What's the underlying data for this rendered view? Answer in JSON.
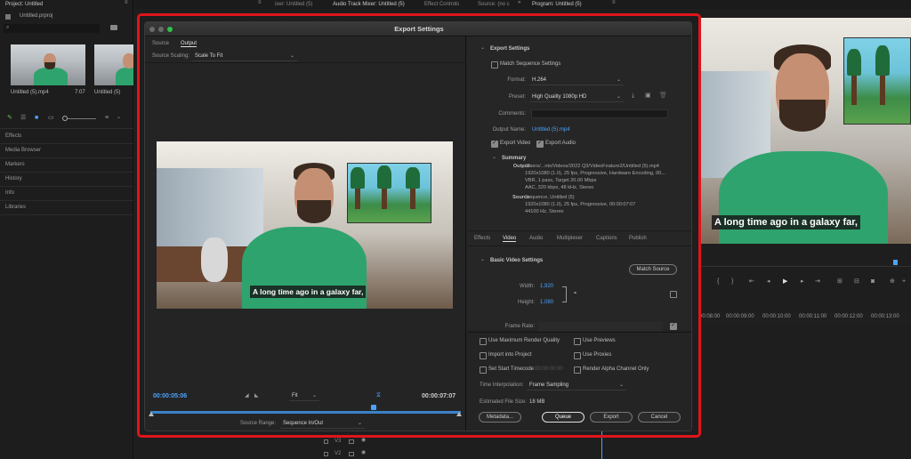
{
  "project": {
    "panel_title": "Project: Untitled",
    "file_name": "Untitled.prproj",
    "items": [
      {
        "name": "Untitled (5).mp4",
        "duration": "7:07"
      },
      {
        "name": "Untitled (5)",
        "duration": ""
      }
    ],
    "menu": [
      "Effects",
      "Media Browser",
      "Markers",
      "History",
      "Info",
      "Libraries"
    ]
  },
  "top_tabs": {
    "source": "ixer: Untitled (5)",
    "audio_mixer": "Audio Track Mixer: Untitled (5)",
    "effect_controls": "Effect Controls",
    "source_none": "Source: (no c",
    "program": "Program: Untitled (5)"
  },
  "program": {
    "subtitle": "A long time ago in a galaxy far,",
    "timecodes": [
      "00:08:00",
      "00:00:09:00",
      "00:00:10:00",
      "00:00:11:00",
      "00:00:12:00",
      "00:00:13:00"
    ]
  },
  "timeline": {
    "tracks": [
      "V3",
      "V2"
    ]
  },
  "dialog": {
    "title": "Export Settings",
    "source_tab": "Source",
    "output_tab": "Output",
    "source_scaling_label": "Source Scaling:",
    "source_scaling_value": "Scale To Fit",
    "preview_subtitle": "A long time ago in a galaxy far,",
    "timecode_in": "00:00:05:06",
    "timecode_out": "00:00:07:07",
    "fit": "Fit",
    "source_range_label": "Source Range:",
    "source_range_value": "Sequence In/Out",
    "export_settings": {
      "header": "Export Settings",
      "match_sequence": "Match Sequence Settings",
      "format_label": "Format:",
      "format_value": "H.264",
      "preset_label": "Preset:",
      "preset_value": "High Quality 1080p HD",
      "comments_label": "Comments:",
      "output_name_label": "Output Name:",
      "output_name_value": "Untitled (5).mp4",
      "export_video": "Export Video",
      "export_audio": "Export Audio"
    },
    "summary": {
      "header": "Summary",
      "output_label": "Output:",
      "output_lines": [
        "/Users/...nts/Videos/2022 Q3/VideoFeature2/Untitled (5).mp4",
        "1920x1080 (1.0), 25 fps, Progressive, Hardware Encoding, 00...",
        "VBR, 1 pass, Target 20.00 Mbps",
        "AAC, 320 kbps, 48 kHz, Stereo"
      ],
      "source_label": "Source:",
      "source_lines": [
        "Sequence, Untitled (5)",
        "1920x1080 (1.0), 25 fps, Progressive, 00:00:07:07",
        "44100 Hz, Stereo"
      ]
    },
    "tabs": [
      "Effects",
      "Video",
      "Audio",
      "Multiplexer",
      "Captions",
      "Publish"
    ],
    "video": {
      "section": "Basic Video Settings",
      "match_source": "Match Source",
      "width_label": "Width:",
      "width_value": "1,920",
      "height_label": "Height:",
      "height_value": "1,080",
      "frame_rate_label": "Frame Rate:",
      "frame_rate_value": "25"
    },
    "options": {
      "max_render": "Use Maximum Render Quality",
      "use_previews": "Use Previews",
      "import_project": "Import into Project",
      "use_proxies": "Use Proxies",
      "set_start_tc": "Set Start Timecode",
      "start_tc_value": "00:00:00:00",
      "render_alpha": "Render Alpha Channel Only",
      "interp_label": "Time Interpolation:",
      "interp_value": "Frame Sampling",
      "file_size_label": "Estimated File Size:",
      "file_size_value": "18 MB"
    },
    "buttons": {
      "metadata": "Metadata...",
      "queue": "Queue",
      "export": "Export",
      "cancel": "Cancel"
    }
  },
  "colors": {
    "highlight_border": "#e0141b",
    "accent_blue": "#4aa3ff",
    "hoodie_green": "#2ea36d"
  }
}
